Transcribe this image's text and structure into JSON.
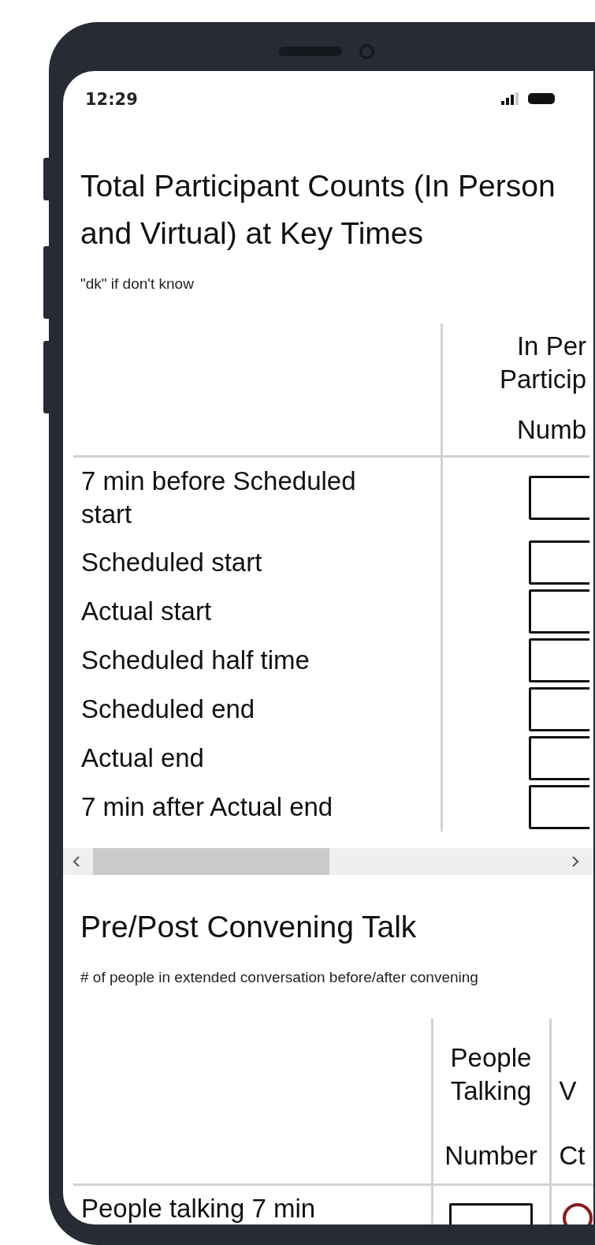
{
  "status_bar": {
    "time": "12:29"
  },
  "sections": [
    {
      "title": "Total Participant Counts (In Person and Virtual) at Key Times",
      "subtitle": "\"dk\" if don't know",
      "table": {
        "kind": "wide",
        "columns": [
          {
            "header_lines": [
              "In Per",
              "Particip"
            ],
            "unit": "Numb",
            "kind": "number"
          }
        ],
        "rows": [
          {
            "label": "7 min before Scheduled start"
          },
          {
            "label": "Scheduled start"
          },
          {
            "label": "Actual start"
          },
          {
            "label": "Scheduled half time"
          },
          {
            "label": "Scheduled end"
          },
          {
            "label": "Actual end"
          },
          {
            "label": "7 min after Actual end"
          }
        ]
      }
    },
    {
      "title": "Pre/Post Convening Talk",
      "subtitle": "# of people in extended conversation before/after convening",
      "table": {
        "kind": "narrow",
        "columns": [
          {
            "header_lines": [
              "People",
              "Talking"
            ],
            "unit": "Number",
            "kind": "number"
          },
          {
            "header_lines": [
              "V"
            ],
            "unit": "Ct",
            "kind": "radio"
          }
        ],
        "rows": [
          {
            "label": "People talking 7 min",
            "checked": false
          }
        ]
      }
    }
  ]
}
